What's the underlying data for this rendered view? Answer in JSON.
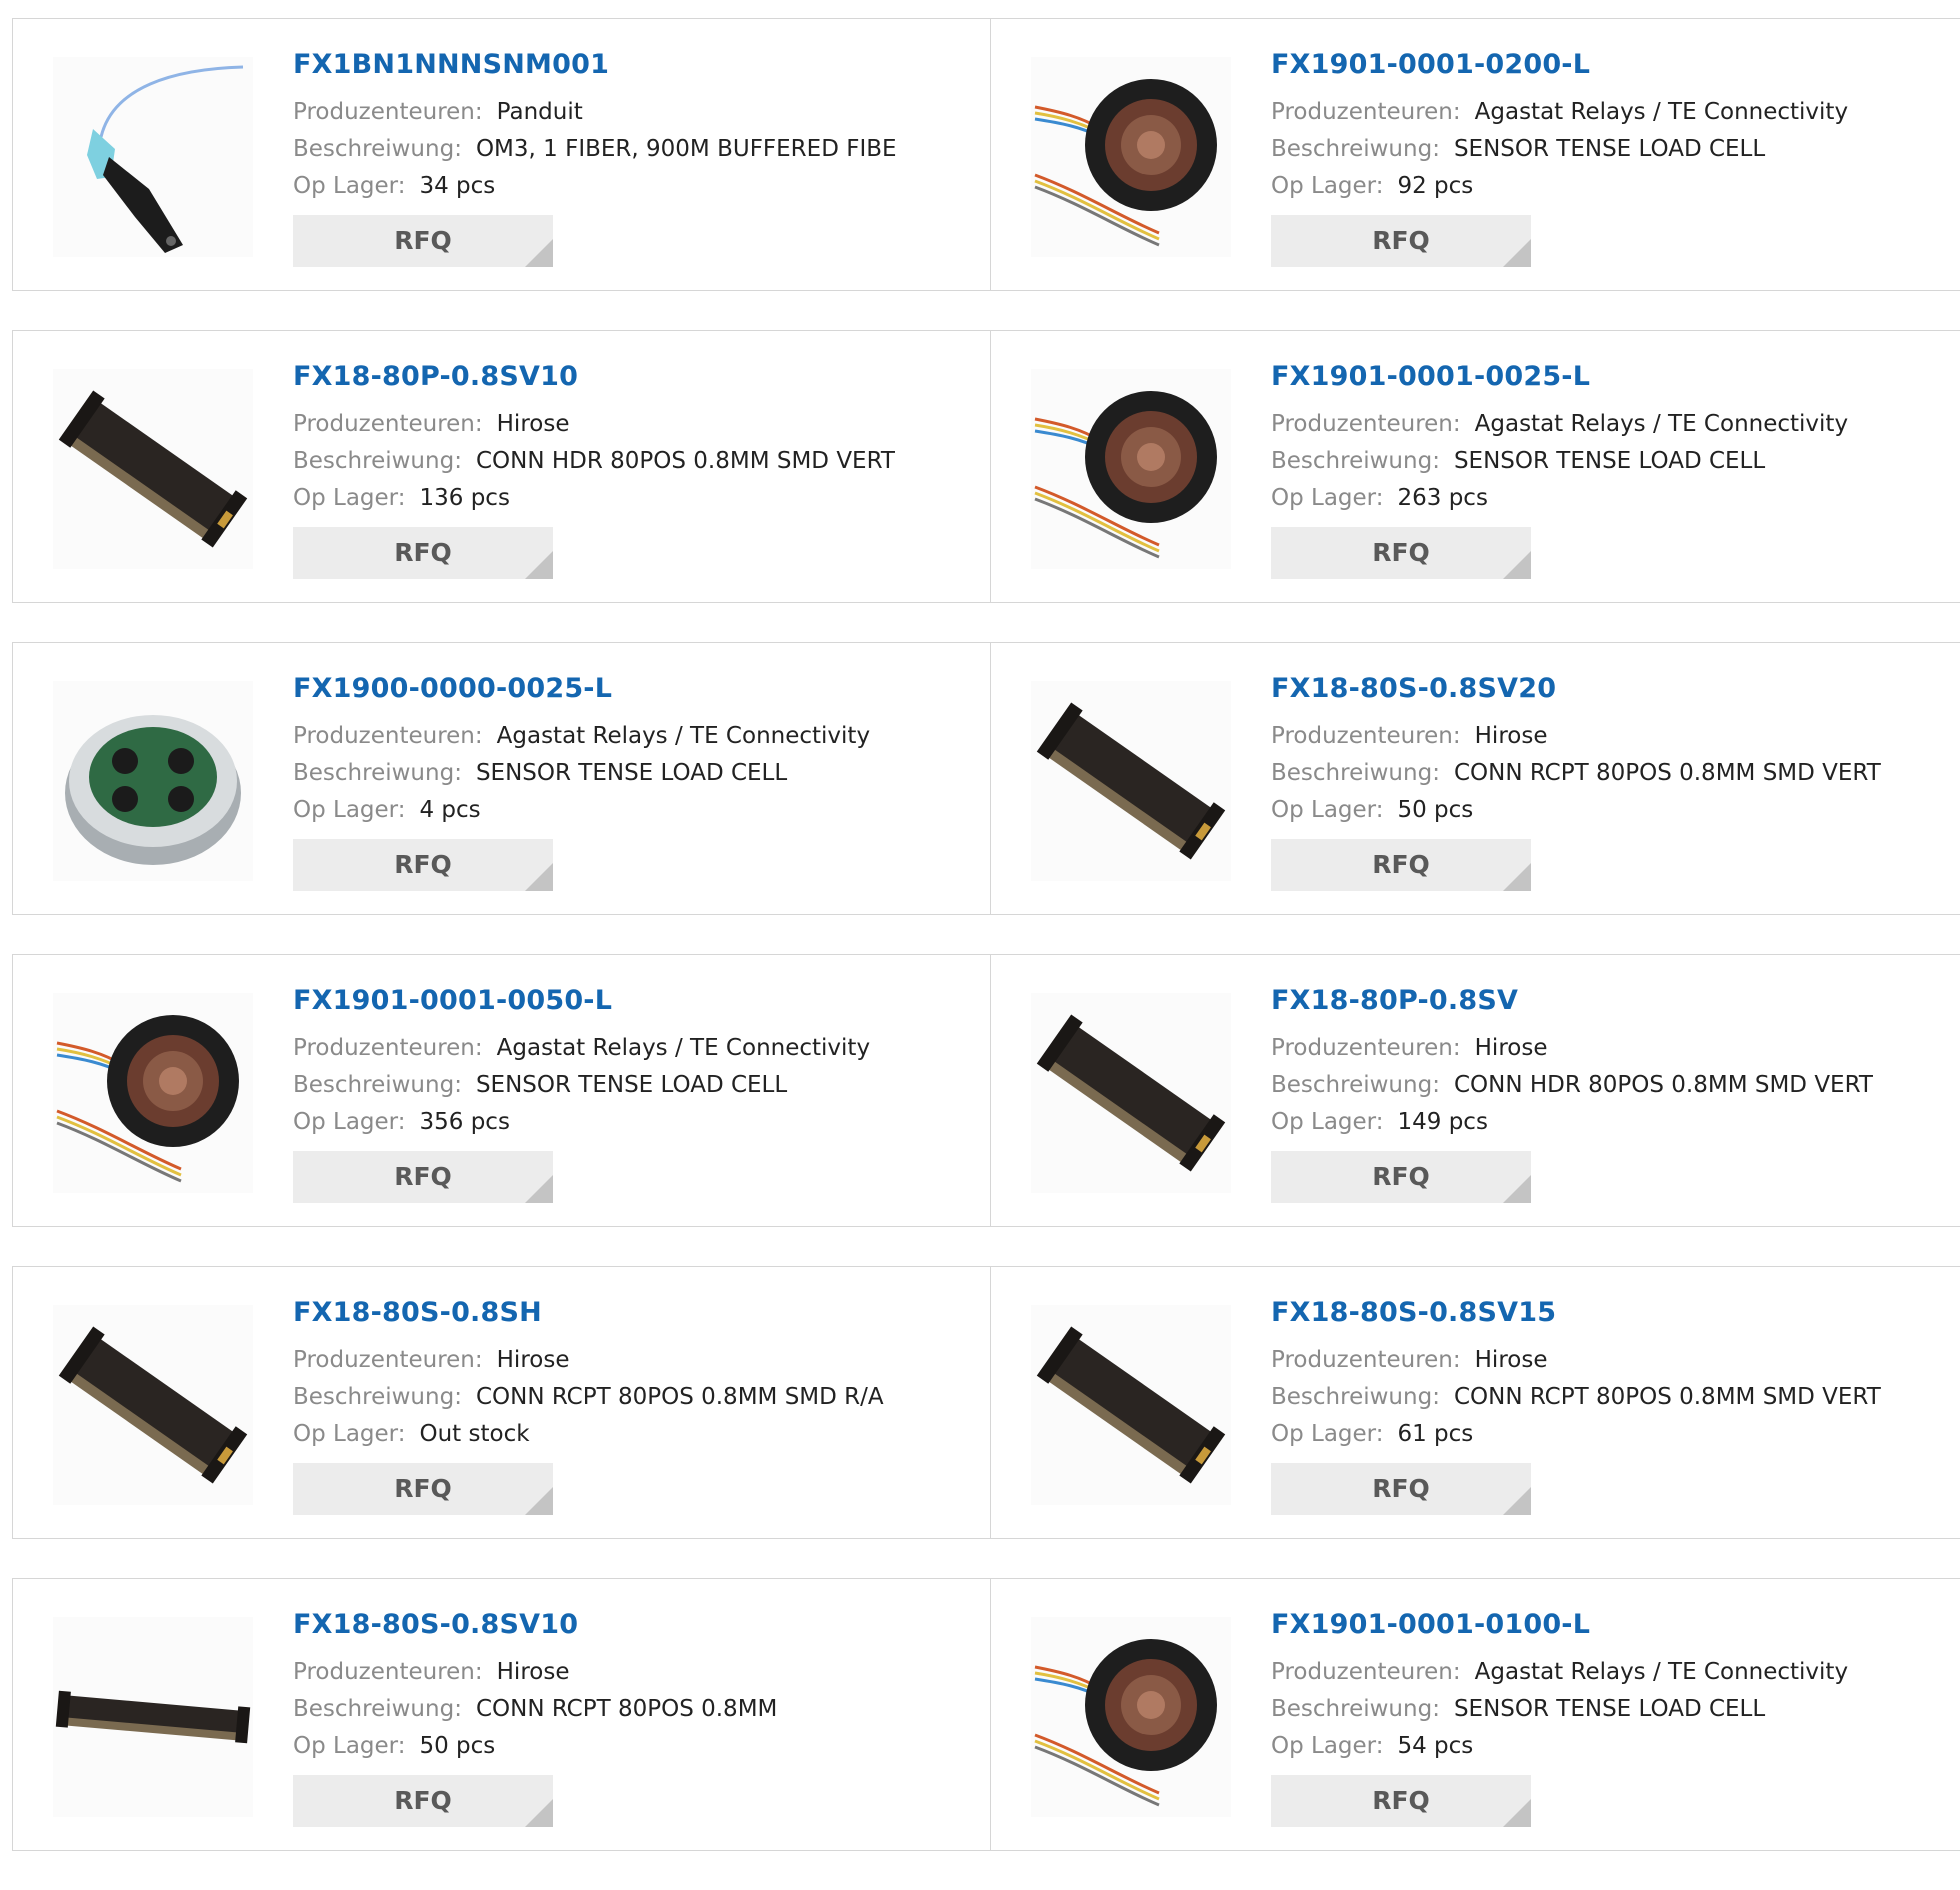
{
  "labels": {
    "manufacturer": "Produzenteuren:",
    "description": "Beschreiwung:",
    "stock": "Op Lager:",
    "rfq": "RFQ"
  },
  "colors": {
    "link": "#1466b0",
    "label": "#8a8a8a",
    "button": "#ececec"
  },
  "products": [
    {
      "part": "FX1BN1NNNSNM001",
      "manufacturer": "Panduit",
      "description": "OM3, 1 FIBER, 900M BUFFERED FIBE",
      "stock": "34 pcs",
      "image": "fiber-cable"
    },
    {
      "part": "FX1901-0001-0200-L",
      "manufacturer": "Agastat Relays / TE Connectivity",
      "description": "SENSOR TENSE LOAD CELL",
      "stock": "92 pcs",
      "image": "load-cell-wired"
    },
    {
      "part": "FX18-80P-0.8SV10",
      "manufacturer": "Hirose",
      "description": "CONN HDR 80POS 0.8MM SMD VERT",
      "stock": "136 pcs",
      "image": "connector"
    },
    {
      "part": "FX1901-0001-0025-L",
      "manufacturer": "Agastat Relays / TE Connectivity",
      "description": "SENSOR TENSE LOAD CELL",
      "stock": "263 pcs",
      "image": "load-cell-wired"
    },
    {
      "part": "FX1900-0000-0025-L",
      "manufacturer": "Agastat Relays / TE Connectivity",
      "description": "SENSOR TENSE LOAD CELL",
      "stock": "4 pcs",
      "image": "load-cell-board"
    },
    {
      "part": "FX18-80S-0.8SV20",
      "manufacturer": "Hirose",
      "description": "CONN RCPT 80POS 0.8MM SMD VERT",
      "stock": "50 pcs",
      "image": "connector"
    },
    {
      "part": "FX1901-0001-0050-L",
      "manufacturer": "Agastat Relays / TE Connectivity",
      "description": "SENSOR TENSE LOAD CELL",
      "stock": "356 pcs",
      "image": "load-cell-wired"
    },
    {
      "part": "FX18-80P-0.8SV",
      "manufacturer": "Hirose",
      "description": "CONN HDR 80POS 0.8MM SMD VERT",
      "stock": "149 pcs",
      "image": "connector"
    },
    {
      "part": "FX18-80S-0.8SH",
      "manufacturer": "Hirose",
      "description": "CONN RCPT 80POS 0.8MM SMD R/A",
      "stock": "Out stock",
      "image": "connector"
    },
    {
      "part": "FX18-80S-0.8SV15",
      "manufacturer": "Hirose",
      "description": "CONN RCPT 80POS 0.8MM SMD VERT",
      "stock": "61 pcs",
      "image": "connector"
    },
    {
      "part": "FX18-80S-0.8SV10",
      "manufacturer": "Hirose",
      "description": "CONN RCPT 80POS 0.8MM",
      "stock": "50 pcs",
      "image": "connector-flat"
    },
    {
      "part": "FX1901-0001-0100-L",
      "manufacturer": "Agastat Relays / TE Connectivity",
      "description": "SENSOR TENSE LOAD CELL",
      "stock": "54 pcs",
      "image": "load-cell-wired"
    }
  ]
}
